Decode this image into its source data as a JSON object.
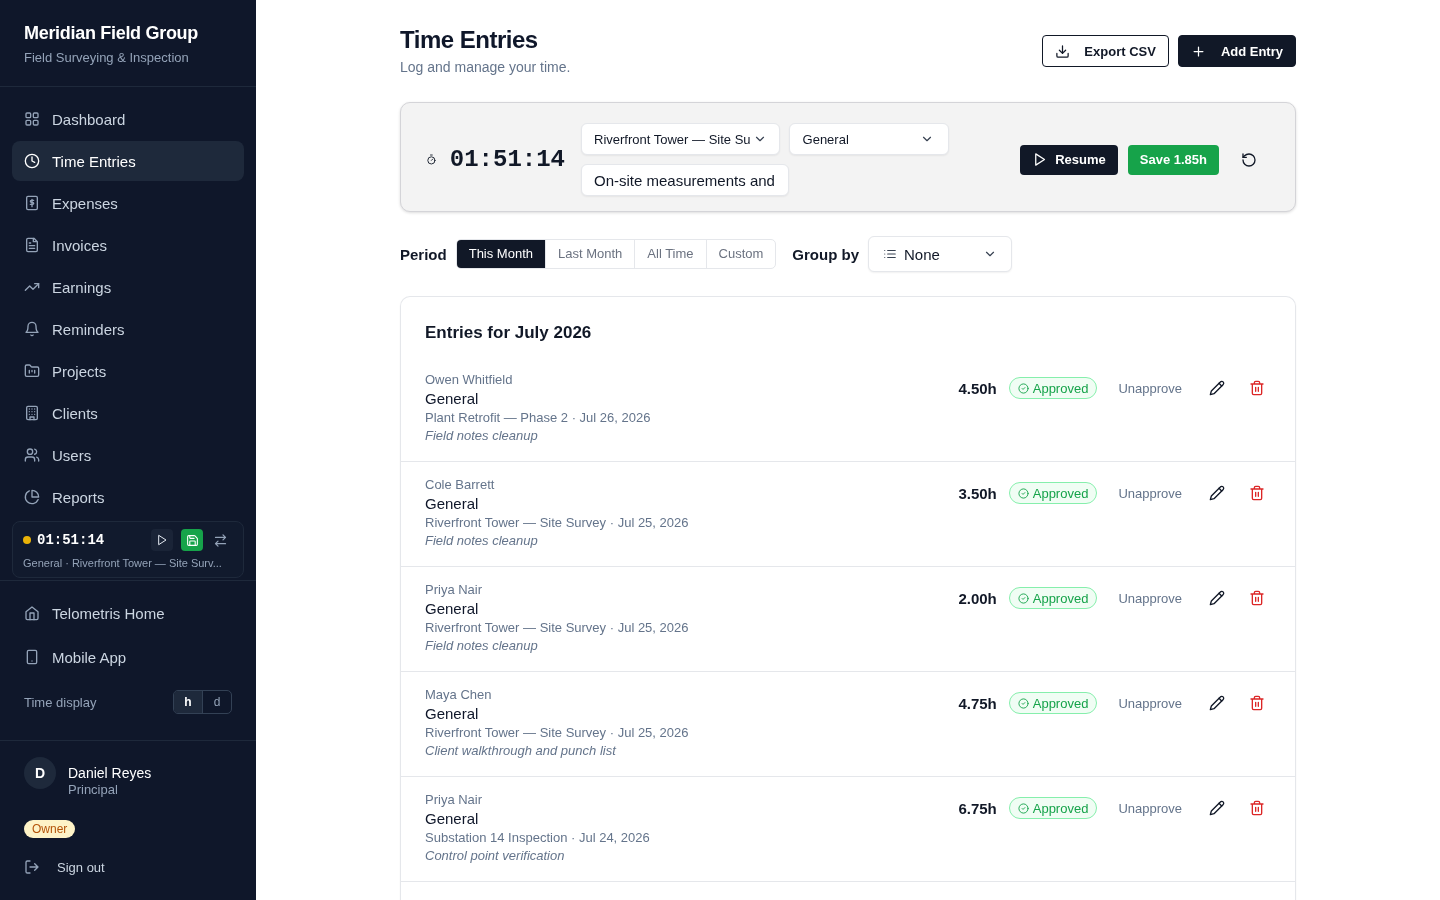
{
  "sidebar": {
    "brand": {
      "title": "Meridian Field Group",
      "subtitle": "Field Surveying & Inspection"
    },
    "nav_items": [
      {
        "label": "Dashboard",
        "selected": false
      },
      {
        "label": "Time Entries",
        "selected": true
      },
      {
        "label": "Expenses",
        "selected": false
      },
      {
        "label": "Invoices",
        "selected": false
      },
      {
        "label": "Earnings",
        "selected": false
      },
      {
        "label": "Reminders",
        "selected": false
      },
      {
        "label": "Projects",
        "selected": false
      },
      {
        "label": "Clients",
        "selected": false
      },
      {
        "label": "Users",
        "selected": false
      },
      {
        "label": "Reports",
        "selected": false
      }
    ],
    "timer_widget": {
      "paused": true,
      "time": "01:51:14",
      "summary": "General · Riverfront Tower — Site Surv..."
    },
    "footer_links": [
      {
        "label": "Telometris Home"
      },
      {
        "label": "Mobile App"
      }
    ],
    "time_display": {
      "label": "Time display",
      "options": [
        {
          "label": "h",
          "selected": true
        },
        {
          "label": "d",
          "selected": false
        }
      ]
    },
    "user": {
      "initial": "D",
      "name": "Daniel Reyes",
      "role": "Principal",
      "badge": "Owner"
    },
    "sign_out": "Sign out"
  },
  "header": {
    "title": "Time Entries",
    "subtitle": "Log and manage your time.",
    "buttons": [
      {
        "label": "Export CSV",
        "kind": "secondary"
      },
      {
        "label": "Add Entry",
        "kind": "primary"
      }
    ]
  },
  "timer": {
    "time": "01:51:14",
    "project": {
      "value": "Riverfront Tower — Site Su"
    },
    "category": {
      "value": "General"
    },
    "description": {
      "value": "On-site measurements and"
    },
    "buttons": [
      {
        "label": "Resume",
        "kind": "resume"
      },
      {
        "label": "Save 1.85h",
        "kind": "save"
      }
    ]
  },
  "filters": {
    "period_label": "Period",
    "periods": [
      {
        "label": "This Month",
        "selected": true
      },
      {
        "label": "Last Month",
        "selected": false
      },
      {
        "label": "All Time",
        "selected": false
      },
      {
        "label": "Custom",
        "selected": false
      }
    ],
    "group_by_label": "Group by",
    "group_by": {
      "value": "None"
    }
  },
  "entries": {
    "title": "Entries for July 2026",
    "rows": [
      {
        "user": "Owen Whitfield",
        "category": "General",
        "meta": "Plant Retrofit — Phase 2 · Jul 26, 2026",
        "note": "Field notes cleanup",
        "hours": "4.50h",
        "status": "Approved",
        "action": "Unapprove"
      },
      {
        "user": "Cole Barrett",
        "category": "General",
        "meta": "Riverfront Tower — Site Survey · Jul 25, 2026",
        "note": "Field notes cleanup",
        "hours": "3.50h",
        "status": "Approved",
        "action": "Unapprove"
      },
      {
        "user": "Priya Nair",
        "category": "General",
        "meta": "Riverfront Tower — Site Survey · Jul 25, 2026",
        "note": "Field notes cleanup",
        "hours": "2.00h",
        "status": "Approved",
        "action": "Unapprove"
      },
      {
        "user": "Maya Chen",
        "category": "General",
        "meta": "Riverfront Tower — Site Survey · Jul 25, 2026",
        "note": "Client walkthrough and punch list",
        "hours": "4.75h",
        "status": "Approved",
        "action": "Unapprove"
      },
      {
        "user": "Priya Nair",
        "category": "General",
        "meta": "Substation 14 Inspection · Jul 24, 2026",
        "note": "Control point verification",
        "hours": "6.75h",
        "status": "Approved",
        "action": "Unapprove"
      }
    ]
  }
}
